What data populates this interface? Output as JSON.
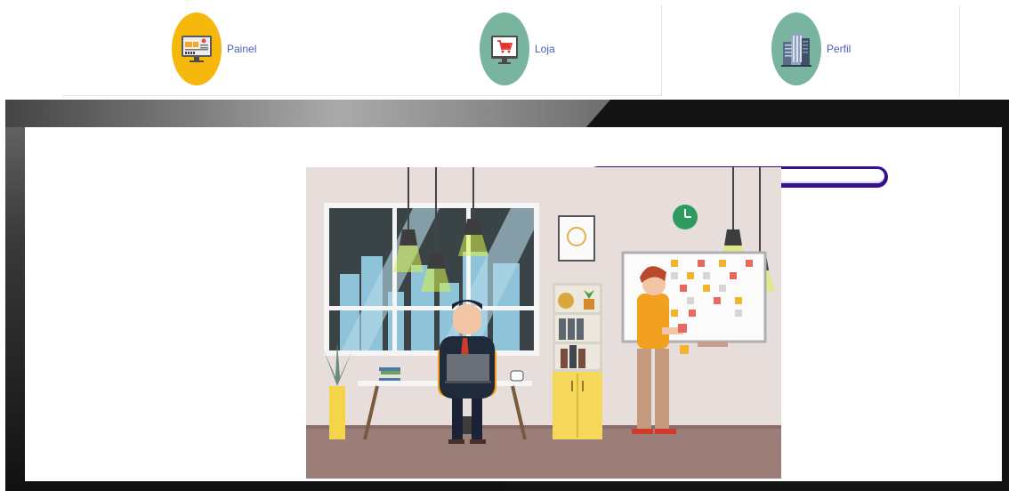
{
  "nav": {
    "items": [
      {
        "label": "Painel",
        "icon": "dashboard-monitor-icon",
        "circle_color": "#f6b80c"
      },
      {
        "label": "Loja",
        "icon": "shopping-cart-monitor-icon",
        "circle_color": "#78b49e"
      },
      {
        "label": "Perfil",
        "icon": "office-building-icon",
        "circle_color": "#78b49e"
      }
    ]
  },
  "banner": {
    "progress_level": 0,
    "illustration": "office-workspace-illustration",
    "colors": {
      "dark": "#141414",
      "progress_border": "#35108f",
      "panel": "#ffffff"
    }
  }
}
